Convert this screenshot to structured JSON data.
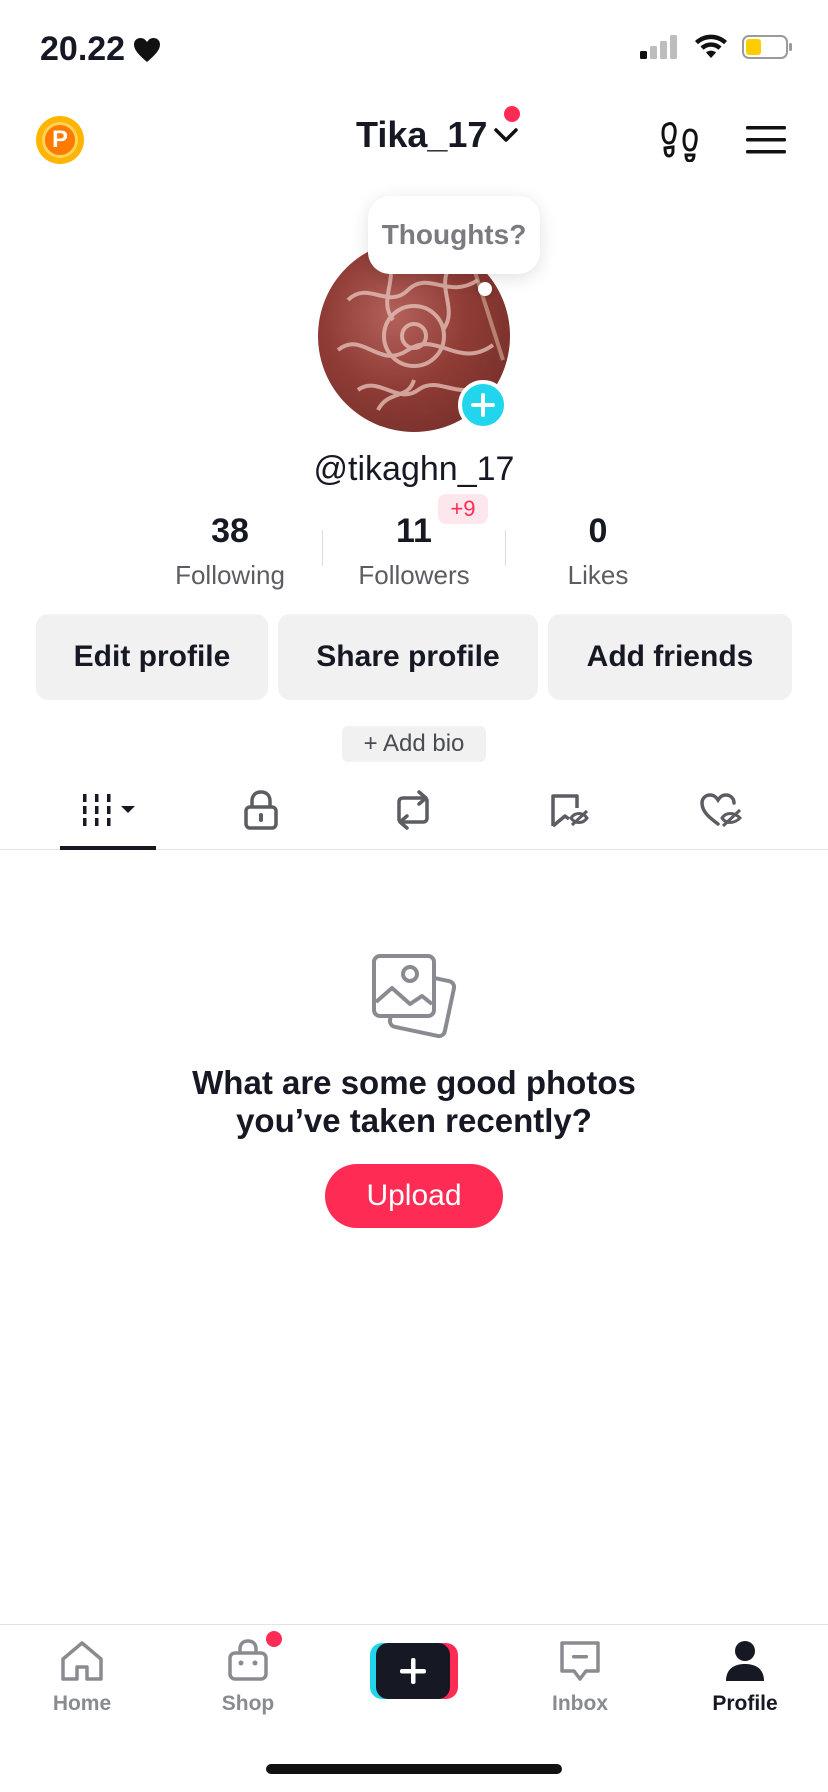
{
  "status_bar": {
    "time": "20.22"
  },
  "header": {
    "coin_letter": "P",
    "username": "Tika_17"
  },
  "profile": {
    "bubble_text": "Thoughts?",
    "handle": "@tikaghn_17",
    "followers_delta": "+9",
    "stats": [
      {
        "value": "38",
        "label": "Following"
      },
      {
        "value": "11",
        "label": "Followers"
      },
      {
        "value": "0",
        "label": "Likes"
      }
    ]
  },
  "buttons": {
    "edit": "Edit profile",
    "share": "Share profile",
    "add_friends": "Add friends",
    "add_bio": "+ Add bio"
  },
  "empty_state": {
    "line1": "What are some good photos",
    "line2": "you’ve taken recently?",
    "upload": "Upload"
  },
  "nav": {
    "home": "Home",
    "shop": "Shop",
    "inbox": "Inbox",
    "profile": "Profile"
  },
  "colors": {
    "accent": "#fe2c55",
    "cyan": "#20d5ec"
  }
}
